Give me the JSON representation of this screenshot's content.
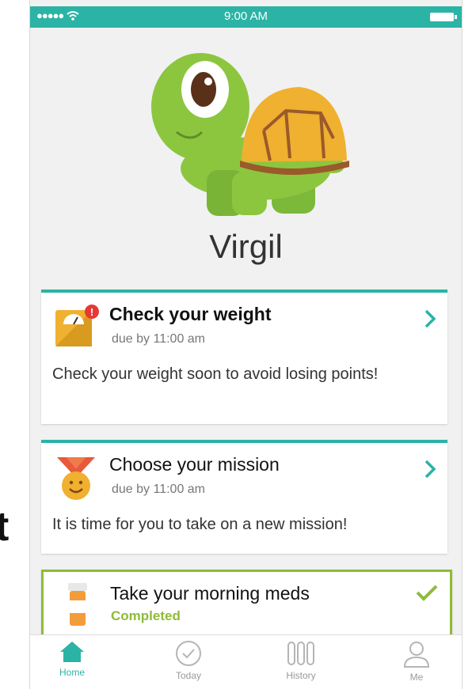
{
  "status_bar": {
    "time": "9:00 AM"
  },
  "pet": {
    "name": "Virgil"
  },
  "tasks": [
    {
      "title": "Check your weight",
      "due": "due by 11:00 am",
      "message": "Check your weight soon to avoid losing points!"
    },
    {
      "title": "Choose your mission",
      "due": "due by 11:00 am",
      "message": "It is time for you to take on a new mission!"
    },
    {
      "title": "Take your morning meds",
      "status": "Completed"
    }
  ],
  "tab_bar": {
    "home": "Home",
    "today": "Today",
    "history": "History",
    "me": "Me"
  },
  "colors": {
    "accent": "#2bb3a5",
    "success": "#8dbb3a",
    "alert": "#e53935"
  },
  "background_text": "t"
}
